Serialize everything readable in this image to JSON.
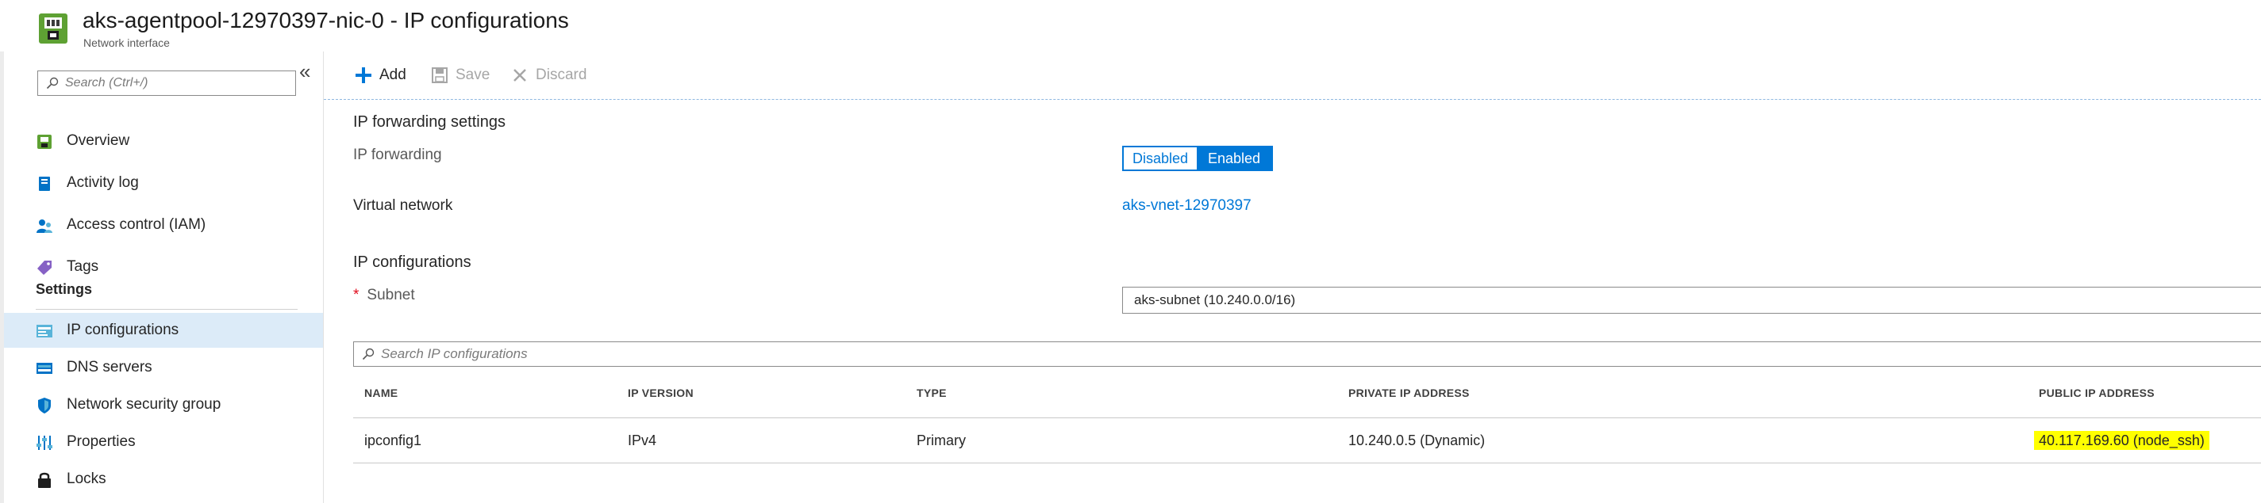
{
  "header": {
    "title": "aks-agentpool-12970397-nic-0 - IP configurations",
    "subtitle": "Network interface",
    "icon": "network-interface-icon"
  },
  "sidebar": {
    "search_placeholder": "Search (Ctrl+/)",
    "collapse_label": "«",
    "items": [
      {
        "label": "Overview",
        "icon": "overview-icon"
      },
      {
        "label": "Activity log",
        "icon": "activity-log-icon"
      },
      {
        "label": "Access control (IAM)",
        "icon": "iam-icon"
      },
      {
        "label": "Tags",
        "icon": "tag-icon"
      }
    ],
    "section_label": "Settings",
    "settings_items": [
      {
        "label": "IP configurations",
        "icon": "ip-config-icon",
        "active": true
      },
      {
        "label": "DNS servers",
        "icon": "dns-icon"
      },
      {
        "label": "Network security group",
        "icon": "shield-icon"
      },
      {
        "label": "Properties",
        "icon": "properties-icon"
      },
      {
        "label": "Locks",
        "icon": "lock-icon"
      }
    ]
  },
  "toolbar": {
    "add_label": "Add",
    "save_label": "Save",
    "discard_label": "Discard"
  },
  "ip_forwarding": {
    "section_title": "IP forwarding settings",
    "label": "IP forwarding",
    "options": [
      "Disabled",
      "Enabled"
    ],
    "selected": "Enabled"
  },
  "virtual_network": {
    "label": "Virtual network",
    "value": "aks-vnet-12970397"
  },
  "ip_configs": {
    "section_title": "IP configurations",
    "subnet_label": "Subnet",
    "required_mark": "*",
    "subnet_value": "aks-subnet (10.240.0.0/16)",
    "search_placeholder": "Search IP configurations",
    "columns": [
      "NAME",
      "IP VERSION",
      "TYPE",
      "PRIVATE IP ADDRESS",
      "PUBLIC IP ADDRESS"
    ],
    "rows": [
      {
        "name": "ipconfig1",
        "ip_version": "IPv4",
        "type": "Primary",
        "private_ip": "10.240.0.5 (Dynamic)",
        "public_ip": "40.117.169.60 (node_ssh)"
      }
    ]
  },
  "colors": {
    "accent": "#0078d7",
    "highlight": "#ffff00",
    "active_nav_bg": "#dcebf8"
  }
}
